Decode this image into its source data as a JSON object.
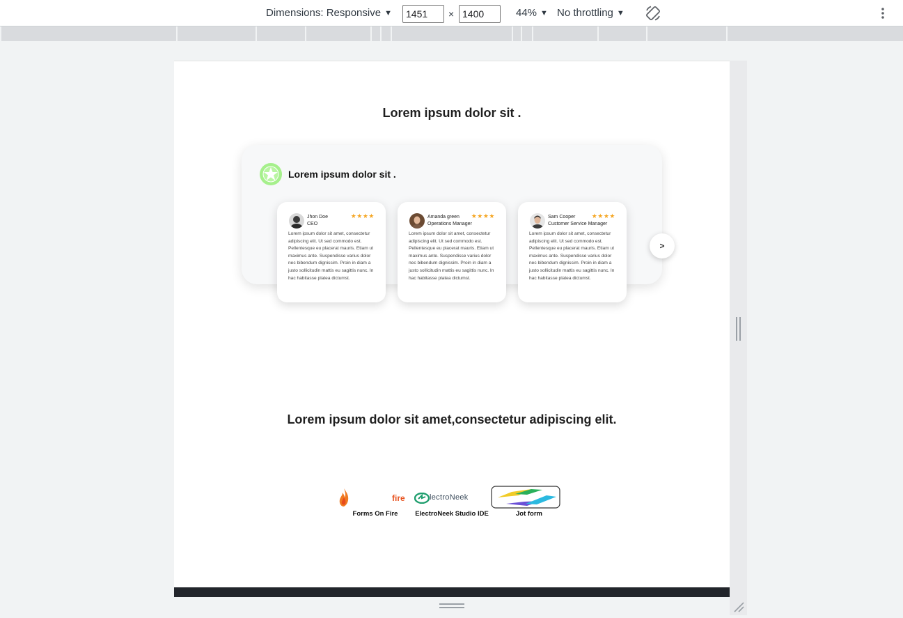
{
  "devtools": {
    "dimensions_label": "Dimensions: Responsive",
    "width_value": "1451",
    "height_value": "1400",
    "times": "×",
    "zoom": "44%",
    "throttling": "No throttling"
  },
  "page": {
    "title": "Lorem ipsum dolor sit .",
    "testimonials": {
      "heading": "Lorem ipsum dolor sit .",
      "next_label": ">",
      "items": [
        {
          "name": "Jhon Doe",
          "role": "CEO",
          "stars": "★★★★",
          "text": "Lorem ipsum dolor sit amet, consectetur adipiscing elit. Ut sed commodo est. Pellentesque eu placerat mauris. Etiam ut maximus ante. Suspendisse varius dolor nec bibendum dignissim. Proin in diam a justo sollicitudin mattis eu sagittis nunc. In hac habitasse platea dictumst."
        },
        {
          "name": "Amanda green",
          "role": "Operations Manager",
          "stars": "★★★★",
          "text": "Lorem ipsum dolor sit amet, consectetur adipiscing elit. Ut sed commodo est. Pellentesque eu placerat mauris. Etiam ut maximus ante. Suspendisse varius dolor nec bibendum dignissim. Proin in diam a justo sollicitudin mattis eu sagittis nunc. In hac habitasse platea dictumst."
        },
        {
          "name": "Sam Cooper",
          "role": "Customer Service Manager",
          "stars": "★★★★",
          "text": "Lorem ipsum dolor sit amet, consectetur adipiscing elit. Ut sed commodo est. Pellentesque eu placerat mauris. Etiam ut maximus ante. Suspendisse varius dolor nec bibendum dignissim. Proin in diam a justo sollicitudin mattis eu sagittis nunc. In hac habitasse platea dictumst."
        }
      ]
    },
    "subtitle": "Lorem ipsum dolor sit amet,consectetur adipiscing elit.",
    "logos": [
      {
        "caption": "Forms On Fire",
        "wordmark": "fire"
      },
      {
        "caption": "ElectroNeek Studio IDE",
        "wordmark": "lectroNeek"
      },
      {
        "caption": "Jot form"
      }
    ]
  },
  "colors": {
    "star": "#f5a623",
    "footer": "#22252b",
    "badge": "#a6f08c"
  }
}
